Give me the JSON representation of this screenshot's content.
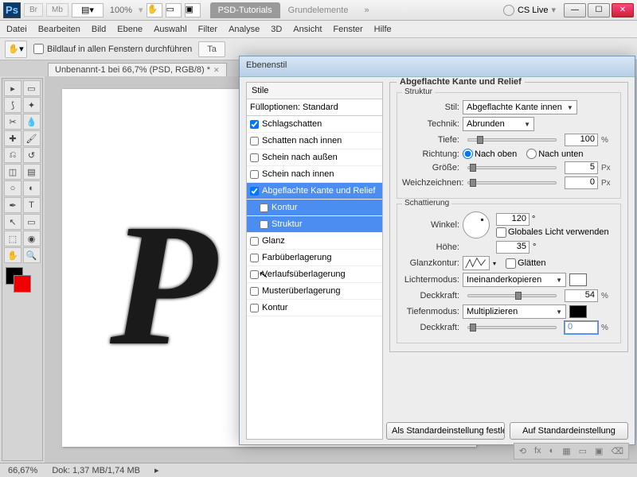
{
  "titlebar": {
    "zoom": "100%",
    "tabs": [
      "PSD-Tutorials",
      "Grundelemente"
    ],
    "active_tab": 0,
    "cs_live": "CS Live"
  },
  "menubar": [
    "Datei",
    "Bearbeiten",
    "Bild",
    "Ebene",
    "Auswahl",
    "Filter",
    "Analyse",
    "3D",
    "Ansicht",
    "Fenster",
    "Hilfe"
  ],
  "optbar": {
    "scroll_label": "Bildlauf in allen Fenstern durchführen",
    "btn_ta": "Ta"
  },
  "doctab": {
    "title": "Unbenannt-1 bei 66,7% (PSD, RGB/8) *"
  },
  "dialog": {
    "title": "Ebenenstil",
    "styles_header": "Stile",
    "fill_opt": "Fülloptionen: Standard",
    "rows": [
      {
        "label": "Schlagschatten",
        "checked": true
      },
      {
        "label": "Schatten nach innen",
        "checked": false
      },
      {
        "label": "Schein nach außen",
        "checked": false
      },
      {
        "label": "Schein nach innen",
        "checked": false
      },
      {
        "label": "Abgeflachte Kante und Relief",
        "checked": true,
        "selected": true
      },
      {
        "label": "Kontur",
        "checked": false,
        "sub": true,
        "selected": true
      },
      {
        "label": "Struktur",
        "checked": false,
        "sub": true,
        "selected": true
      },
      {
        "label": "Glanz",
        "checked": false
      },
      {
        "label": "Farbüberlagerung",
        "checked": false
      },
      {
        "label": "Verlaufsüberlagerung",
        "checked": false
      },
      {
        "label": "Musterüberlagerung",
        "checked": false
      },
      {
        "label": "Kontur",
        "checked": false
      }
    ],
    "section_title": "Abgeflachte Kante und Relief",
    "struktur": {
      "legend": "Struktur",
      "stil_label": "Stil:",
      "stil_val": "Abgeflachte Kante innen",
      "technik_label": "Technik:",
      "technik_val": "Abrunden",
      "tiefe_label": "Tiefe:",
      "tiefe_val": "100",
      "tiefe_unit": "%",
      "richtung_label": "Richtung:",
      "r_up": "Nach oben",
      "r_down": "Nach unten",
      "groesse_label": "Größe:",
      "groesse_val": "5",
      "groesse_unit": "Px",
      "weich_label": "Weichzeichnen:",
      "weich_val": "0",
      "weich_unit": "Px"
    },
    "schatt": {
      "legend": "Schattierung",
      "winkel_label": "Winkel:",
      "winkel_val": "120",
      "deg": "°",
      "global": "Globales Licht verwenden",
      "hoehe_label": "Höhe:",
      "hoehe_val": "35",
      "glanz_label": "Glanzkontur:",
      "glaetten": "Glätten",
      "licht_label": "Lichtermodus:",
      "licht_val": "Ineinanderkopieren",
      "deck_label": "Deckkraft:",
      "deck1_val": "54",
      "pct": "%",
      "tief_label": "Tiefenmodus:",
      "tief_val": "Multiplizieren",
      "deck2_val": "0"
    },
    "footer": {
      "default": "Als Standardeinstellung festlegen",
      "reset": "Auf Standardeinstellung"
    }
  },
  "status": {
    "zoom": "66,67%",
    "doc": "Dok: 1,37 MB/1,74 MB"
  },
  "letter": "P",
  "bottom_icons": [
    "⟲",
    "fx",
    "◐",
    "▦",
    "▭",
    "▣",
    "⌫"
  ]
}
